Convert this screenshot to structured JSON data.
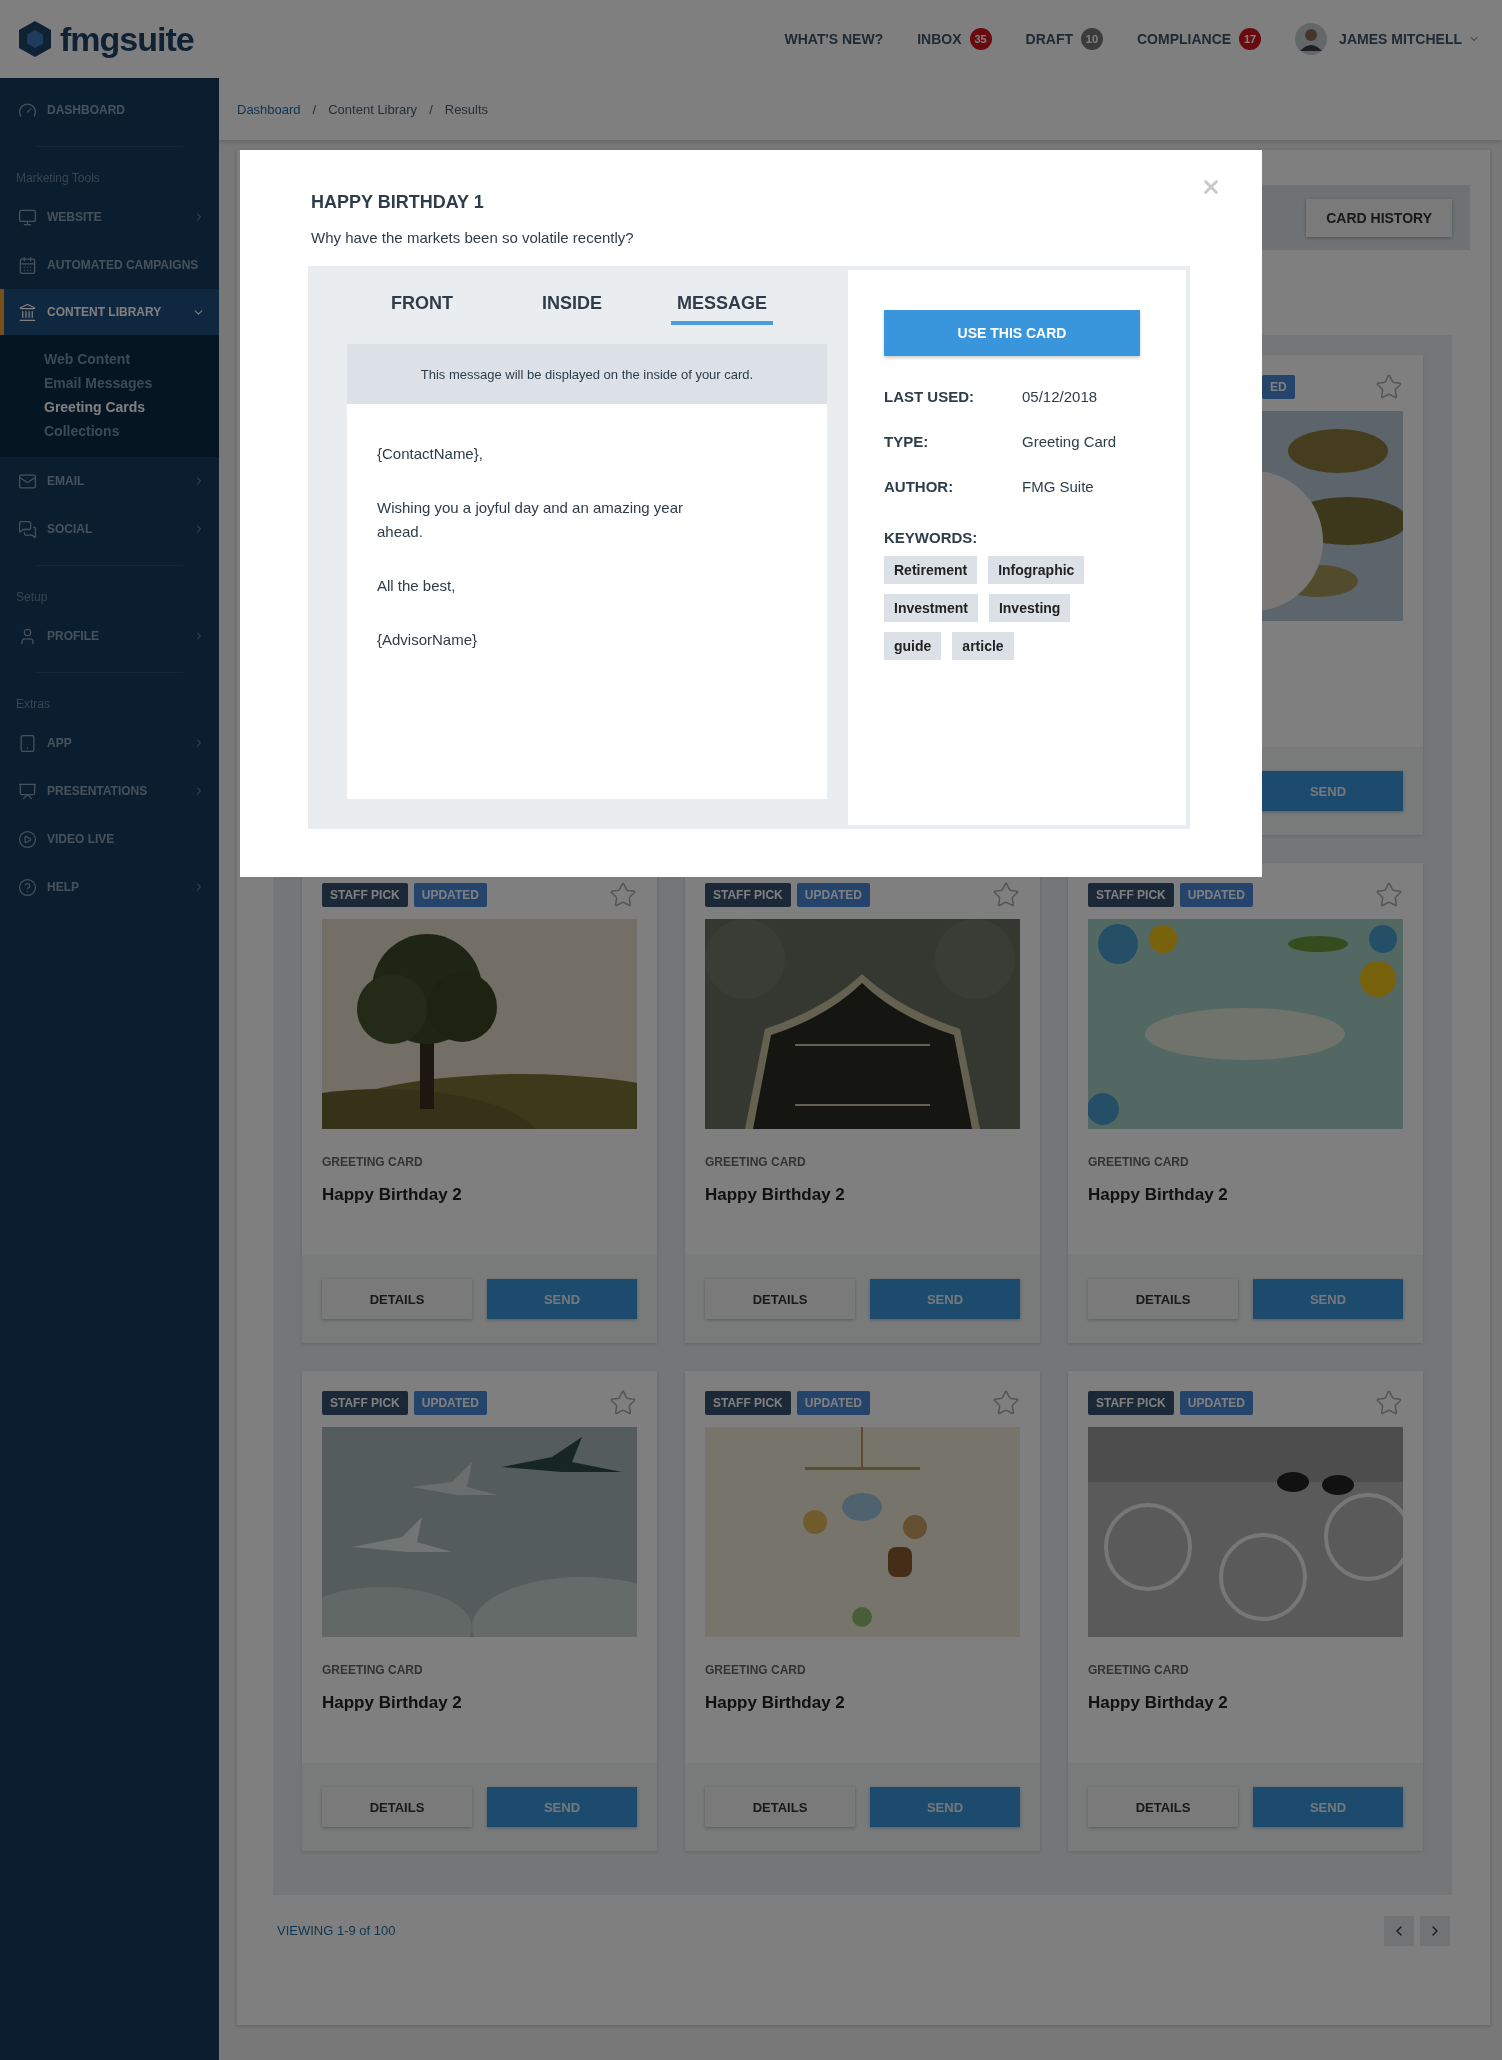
{
  "header": {
    "logo": "fmgsuite",
    "nav": [
      {
        "label": "WHAT'S NEW?"
      },
      {
        "label": "INBOX",
        "count": "35",
        "kind": "alert"
      },
      {
        "label": "DRAFT",
        "count": "10",
        "kind": "neutral"
      },
      {
        "label": "COMPLIANCE",
        "count": "17",
        "kind": "alert"
      }
    ],
    "user": "JAMES MITCHELL"
  },
  "sidebar": {
    "groups": [
      {
        "items": [
          {
            "label": "DASHBOARD",
            "chevron": false,
            "selected": false
          }
        ]
      },
      {
        "heading": "Marketing Tools",
        "items": [
          {
            "label": "WEBSITE",
            "chevron": true,
            "selected": false
          },
          {
            "label": "AUTOMATED CAMPAIGNS",
            "chevron": false,
            "selected": false
          },
          {
            "label": "CONTENT LIBRARY",
            "chevron": true,
            "selected": true,
            "expanded": true,
            "children": [
              {
                "label": "Web Content",
                "selected": false
              },
              {
                "label": "Email Messages",
                "selected": false
              },
              {
                "label": "Greeting Cards",
                "selected": true
              },
              {
                "label": "Collections",
                "selected": false
              }
            ]
          },
          {
            "label": "EMAIL",
            "chevron": true,
            "selected": false
          },
          {
            "label": "SOCIAL",
            "chevron": true,
            "selected": false
          }
        ]
      },
      {
        "heading": "Setup",
        "items": [
          {
            "label": "PROFILE",
            "chevron": true,
            "selected": false
          }
        ]
      },
      {
        "heading": "Extras",
        "items": [
          {
            "label": "APP",
            "chevron": true,
            "selected": false
          },
          {
            "label": "PRESENTATIONS",
            "chevron": true,
            "selected": false
          },
          {
            "label": "VIDEO LIVE",
            "chevron": false,
            "selected": false
          },
          {
            "label": "HELP",
            "chevron": true,
            "selected": false
          }
        ]
      }
    ]
  },
  "breadcrumb": [
    {
      "label": "Dashboard",
      "separator": "/"
    },
    {
      "label": "Content Library",
      "separator": "/"
    },
    {
      "label": "Results"
    }
  ],
  "toolbar": {
    "button": "CARD HISTORY"
  },
  "partial_card": {
    "badge": "ED",
    "starred": false,
    "picture": {
      "kind": "picture"
    },
    "button": "SEND"
  },
  "cards": [
    {
      "badges": [
        {
          "kind": "staff",
          "label": "STAFF PICK"
        },
        {
          "kind": "updated",
          "label": "UPDATED"
        }
      ],
      "starred": false,
      "picture": {
        "kind": "picture"
      },
      "category": "GREETING CARD",
      "title": "Happy Birthday 2",
      "details": "DETAILS",
      "send": "SEND"
    },
    {
      "badges": [
        {
          "kind": "staff",
          "label": "STAFF PICK"
        },
        {
          "kind": "updated",
          "label": "UPDATED"
        }
      ],
      "starred": false,
      "picture": {
        "kind": "picture"
      },
      "category": "GREETING CARD",
      "title": "Happy Birthday 2",
      "details": "DETAILS",
      "send": "SEND"
    },
    {
      "badges": [
        {
          "kind": "staff",
          "label": "STAFF PICK"
        },
        {
          "kind": "updated",
          "label": "UPDATED"
        }
      ],
      "starred": false,
      "picture": {
        "kind": "picture"
      },
      "category": "GREETING CARD",
      "title": "Happy Birthday 2",
      "details": "DETAILS",
      "send": "SEND"
    },
    {
      "badges": [
        {
          "kind": "staff",
          "label": "STAFF PICK"
        },
        {
          "kind": "updated",
          "label": "UPDATED"
        }
      ],
      "starred": false,
      "picture": {
        "kind": "picture"
      },
      "category": "GREETING CARD",
      "title": "Happy Birthday 2",
      "details": "DETAILS",
      "send": "SEND"
    },
    {
      "badges": [
        {
          "kind": "staff",
          "label": "STAFF PICK"
        },
        {
          "kind": "updated",
          "label": "UPDATED"
        }
      ],
      "starred": false,
      "picture": {
        "kind": "picture"
      },
      "category": "GREETING CARD",
      "title": "Happy Birthday 2",
      "details": "DETAILS",
      "send": "SEND"
    },
    {
      "badges": [
        {
          "kind": "staff",
          "label": "STAFF PICK"
        },
        {
          "kind": "updated",
          "label": "UPDATED"
        }
      ],
      "starred": false,
      "picture": {
        "kind": "picture"
      },
      "category": "GREETING CARD",
      "title": "Happy Birthday 2",
      "details": "DETAILS",
      "send": "SEND"
    }
  ],
  "footer": {
    "viewing": "VIEWING 1-9 of 100"
  },
  "modal": {
    "title": "HAPPY BIRTHDAY 1",
    "subtitle": "Why have the markets been so volatile recently?",
    "tabs": [
      {
        "label": "FRONT",
        "selected": false
      },
      {
        "label": "INSIDE",
        "selected": false
      },
      {
        "label": "MESSAGE",
        "selected": true
      }
    ],
    "notice": "This message will be displayed on the inside of your card.",
    "message": [
      "{ContactName},",
      "Wishing you a joyful day and an amazing year ahead.",
      "All the best,",
      "{AdvisorName}"
    ],
    "action": "USE THIS CARD",
    "details": [
      {
        "label": "LAST USED:",
        "value": "05/12/2018"
      },
      {
        "label": "TYPE:",
        "value": "Greeting Card"
      },
      {
        "label": "AUTHOR:",
        "value": "FMG Suite"
      }
    ],
    "keywords_label": "KEYWORDS:",
    "keywords": [
      "Retirement",
      "Infographic",
      "Investment",
      "Investing",
      "guide",
      "article"
    ]
  }
}
